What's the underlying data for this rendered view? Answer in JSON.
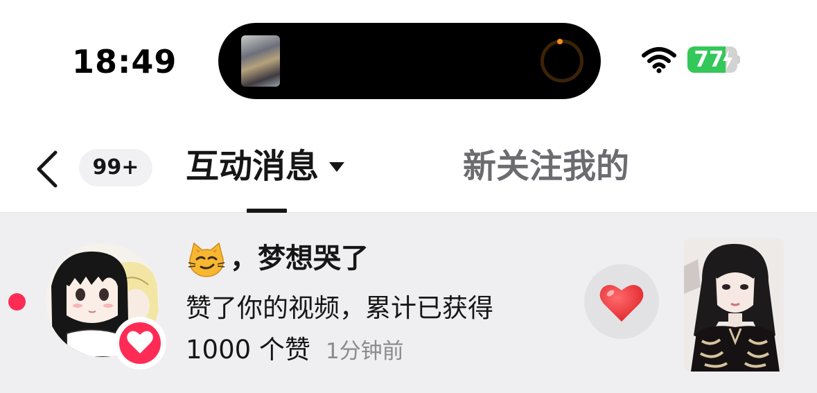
{
  "status_bar": {
    "time": "18:49",
    "battery_percent": "77",
    "battery_level": 0.77,
    "battery_charging": true,
    "battery_color": "#34c759",
    "wifi_icon": "wifi-icon",
    "island_activity": "media-artwork-and-progress-ring"
  },
  "nav": {
    "back_icon": "chevron-left-icon",
    "unread_badge": "99+",
    "tabs": [
      {
        "label": "互动消息",
        "active": true,
        "has_dropdown": true
      },
      {
        "label": "新关注我的",
        "active": false
      }
    ]
  },
  "notification": {
    "unread": true,
    "unread_dot_color": "#fe2c55",
    "emoji_icon": "smirking-cat-icon",
    "title_suffix": "，梦想哭了",
    "line2": "赞了你的视频，累计已获得",
    "line3": "1000 个赞",
    "time_ago": "1分钟前",
    "badge_icon": "heart-icon",
    "action_icon": "heart-icon",
    "accent": "#fe2c55"
  }
}
